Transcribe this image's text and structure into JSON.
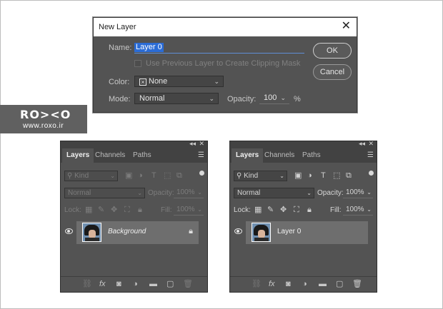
{
  "dialog": {
    "title": "New Layer",
    "close_glyph": "✕",
    "name_label": "Name:",
    "name_value": "Layer 0",
    "clipping_label": "Use Previous Layer to Create Clipping Mask",
    "color_label": "Color:",
    "color_value": "None",
    "mode_label": "Mode:",
    "mode_value": "Normal",
    "opacity_label": "Opacity:",
    "opacity_value": "100",
    "opacity_unit": "%",
    "ok_label": "OK",
    "cancel_label": "Cancel"
  },
  "logo": {
    "main": "RO><O",
    "url": "www.roxo.ir"
  },
  "panel_left": {
    "tabs": [
      "Layers",
      "Channels",
      "Paths"
    ],
    "kind_label": "Kind",
    "blend_value": "Normal",
    "opacity_label": "Opacity:",
    "opacity_value": "100%",
    "lock_label": "Lock:",
    "fill_label": "Fill:",
    "fill_value": "100%",
    "layer_name": "Background"
  },
  "panel_right": {
    "tabs": [
      "Layers",
      "Channels",
      "Paths"
    ],
    "kind_label": "Kind",
    "blend_value": "Normal",
    "opacity_label": "Opacity:",
    "opacity_value": "100%",
    "lock_label": "Lock:",
    "fill_label": "Fill:",
    "fill_value": "100%",
    "layer_name": "Layer 0"
  },
  "glyphs": {
    "collapse": "◂◂",
    "close": "✕",
    "menu": "☰",
    "chevron": "⌄",
    "search": "⚲",
    "fx": "fx",
    "lock": "🔒"
  },
  "colors": {
    "panel_bg": "#535353",
    "selection_blue": "#2b6cd6",
    "layer_highlight": "#6e6e6e"
  }
}
